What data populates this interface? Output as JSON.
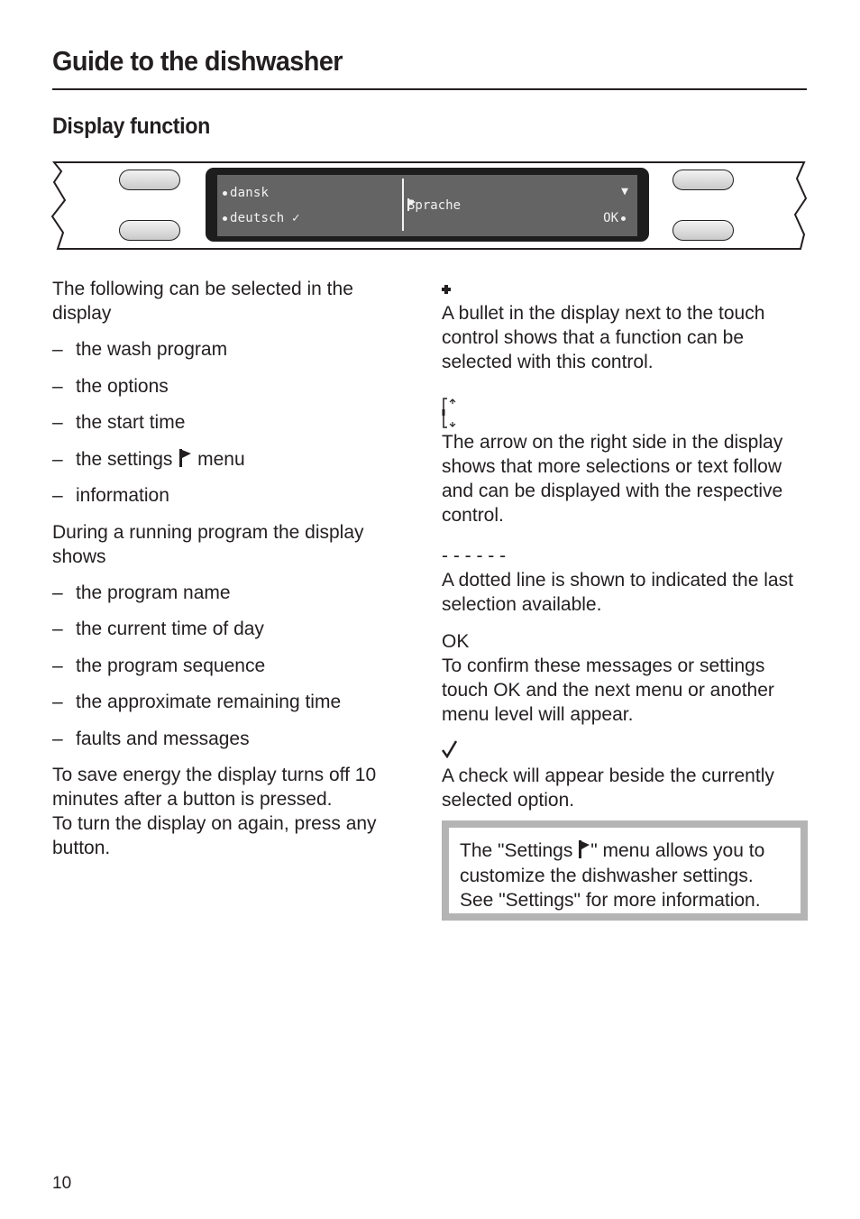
{
  "header": {
    "title": "Guide to the dishwasher",
    "section": "Display function"
  },
  "display_panel": {
    "options": [
      {
        "label": "dansk",
        "selected": false
      },
      {
        "label": "deutsch",
        "selected": true
      }
    ],
    "heading": "Sprache",
    "scroll_arrow": "▼",
    "ok_label": "OK",
    "check_glyph": "✓"
  },
  "left_column": {
    "intro": "The following can be selected in the display",
    "selectable_items": [
      "the wash program",
      "the options",
      "the start time",
      "the settings",
      "information"
    ],
    "settings_item_suffix": "menu",
    "running_intro": "During a running program the display shows",
    "running_items": [
      "the program name",
      "the current time of day",
      "the program sequence",
      "the approximate remaining time",
      "faults and messages"
    ],
    "energy_note": "To save energy the display turns off 10 minutes after a button is pressed.",
    "turn_on_note": "To turn the display on again, press any button.",
    "dash": "–"
  },
  "right_column": {
    "bullet_text": "A bullet in the display next to the touch control shows that a function can be selected with this control.",
    "arrow_text": "The arrow on the right side in the display shows that more selections or text follow and can be displayed with the respective control.",
    "dotted_symbol": "- - - - - -",
    "dotted_text": "A dotted line is shown to indicated the last selection available.",
    "ok_symbol": "OK",
    "ok_text": "To confirm these messages or settings touch OK and the next menu or another menu level will appear.",
    "check_text": "A check will appear beside the currently selected option."
  },
  "note_box": {
    "text_before_icon": "The \"Settings ",
    "text_after_icon": "\" menu allows you to customize the dishwasher settings. See \"Settings\" for more information."
  },
  "footer": {
    "page_number": "10"
  }
}
